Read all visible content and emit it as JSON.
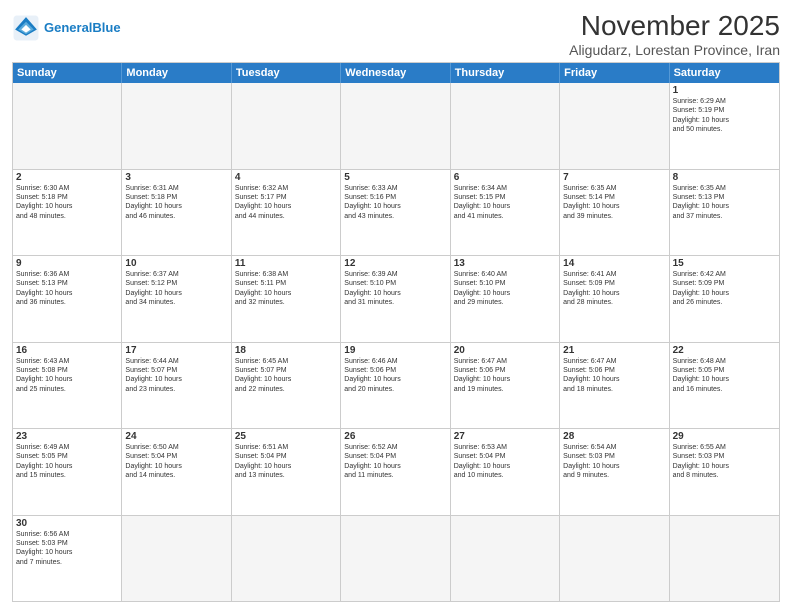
{
  "header": {
    "logo_general": "General",
    "logo_blue": "Blue",
    "month_title": "November 2025",
    "subtitle": "Aligudarz, Lorestan Province, Iran"
  },
  "weekdays": [
    "Sunday",
    "Monday",
    "Tuesday",
    "Wednesday",
    "Thursday",
    "Friday",
    "Saturday"
  ],
  "rows": [
    [
      {
        "day": "",
        "info": "",
        "empty": true
      },
      {
        "day": "",
        "info": "",
        "empty": true
      },
      {
        "day": "",
        "info": "",
        "empty": true
      },
      {
        "day": "",
        "info": "",
        "empty": true
      },
      {
        "day": "",
        "info": "",
        "empty": true
      },
      {
        "day": "",
        "info": "",
        "empty": true
      },
      {
        "day": "1",
        "info": "Sunrise: 6:29 AM\nSunset: 5:19 PM\nDaylight: 10 hours\nand 50 minutes."
      }
    ],
    [
      {
        "day": "2",
        "info": "Sunrise: 6:30 AM\nSunset: 5:18 PM\nDaylight: 10 hours\nand 48 minutes."
      },
      {
        "day": "3",
        "info": "Sunrise: 6:31 AM\nSunset: 5:18 PM\nDaylight: 10 hours\nand 46 minutes."
      },
      {
        "day": "4",
        "info": "Sunrise: 6:32 AM\nSunset: 5:17 PM\nDaylight: 10 hours\nand 44 minutes."
      },
      {
        "day": "5",
        "info": "Sunrise: 6:33 AM\nSunset: 5:16 PM\nDaylight: 10 hours\nand 43 minutes."
      },
      {
        "day": "6",
        "info": "Sunrise: 6:34 AM\nSunset: 5:15 PM\nDaylight: 10 hours\nand 41 minutes."
      },
      {
        "day": "7",
        "info": "Sunrise: 6:35 AM\nSunset: 5:14 PM\nDaylight: 10 hours\nand 39 minutes."
      },
      {
        "day": "8",
        "info": "Sunrise: 6:35 AM\nSunset: 5:13 PM\nDaylight: 10 hours\nand 37 minutes."
      }
    ],
    [
      {
        "day": "9",
        "info": "Sunrise: 6:36 AM\nSunset: 5:13 PM\nDaylight: 10 hours\nand 36 minutes."
      },
      {
        "day": "10",
        "info": "Sunrise: 6:37 AM\nSunset: 5:12 PM\nDaylight: 10 hours\nand 34 minutes."
      },
      {
        "day": "11",
        "info": "Sunrise: 6:38 AM\nSunset: 5:11 PM\nDaylight: 10 hours\nand 32 minutes."
      },
      {
        "day": "12",
        "info": "Sunrise: 6:39 AM\nSunset: 5:10 PM\nDaylight: 10 hours\nand 31 minutes."
      },
      {
        "day": "13",
        "info": "Sunrise: 6:40 AM\nSunset: 5:10 PM\nDaylight: 10 hours\nand 29 minutes."
      },
      {
        "day": "14",
        "info": "Sunrise: 6:41 AM\nSunset: 5:09 PM\nDaylight: 10 hours\nand 28 minutes."
      },
      {
        "day": "15",
        "info": "Sunrise: 6:42 AM\nSunset: 5:09 PM\nDaylight: 10 hours\nand 26 minutes."
      }
    ],
    [
      {
        "day": "16",
        "info": "Sunrise: 6:43 AM\nSunset: 5:08 PM\nDaylight: 10 hours\nand 25 minutes."
      },
      {
        "day": "17",
        "info": "Sunrise: 6:44 AM\nSunset: 5:07 PM\nDaylight: 10 hours\nand 23 minutes."
      },
      {
        "day": "18",
        "info": "Sunrise: 6:45 AM\nSunset: 5:07 PM\nDaylight: 10 hours\nand 22 minutes."
      },
      {
        "day": "19",
        "info": "Sunrise: 6:46 AM\nSunset: 5:06 PM\nDaylight: 10 hours\nand 20 minutes."
      },
      {
        "day": "20",
        "info": "Sunrise: 6:47 AM\nSunset: 5:06 PM\nDaylight: 10 hours\nand 19 minutes."
      },
      {
        "day": "21",
        "info": "Sunrise: 6:47 AM\nSunset: 5:06 PM\nDaylight: 10 hours\nand 18 minutes."
      },
      {
        "day": "22",
        "info": "Sunrise: 6:48 AM\nSunset: 5:05 PM\nDaylight: 10 hours\nand 16 minutes."
      }
    ],
    [
      {
        "day": "23",
        "info": "Sunrise: 6:49 AM\nSunset: 5:05 PM\nDaylight: 10 hours\nand 15 minutes."
      },
      {
        "day": "24",
        "info": "Sunrise: 6:50 AM\nSunset: 5:04 PM\nDaylight: 10 hours\nand 14 minutes."
      },
      {
        "day": "25",
        "info": "Sunrise: 6:51 AM\nSunset: 5:04 PM\nDaylight: 10 hours\nand 13 minutes."
      },
      {
        "day": "26",
        "info": "Sunrise: 6:52 AM\nSunset: 5:04 PM\nDaylight: 10 hours\nand 11 minutes."
      },
      {
        "day": "27",
        "info": "Sunrise: 6:53 AM\nSunset: 5:04 PM\nDaylight: 10 hours\nand 10 minutes."
      },
      {
        "day": "28",
        "info": "Sunrise: 6:54 AM\nSunset: 5:03 PM\nDaylight: 10 hours\nand 9 minutes."
      },
      {
        "day": "29",
        "info": "Sunrise: 6:55 AM\nSunset: 5:03 PM\nDaylight: 10 hours\nand 8 minutes."
      }
    ],
    [
      {
        "day": "30",
        "info": "Sunrise: 6:56 AM\nSunset: 5:03 PM\nDaylight: 10 hours\nand 7 minutes."
      },
      {
        "day": "",
        "info": "",
        "empty": true
      },
      {
        "day": "",
        "info": "",
        "empty": true
      },
      {
        "day": "",
        "info": "",
        "empty": true
      },
      {
        "day": "",
        "info": "",
        "empty": true
      },
      {
        "day": "",
        "info": "",
        "empty": true
      },
      {
        "day": "",
        "info": "",
        "empty": true
      }
    ]
  ]
}
